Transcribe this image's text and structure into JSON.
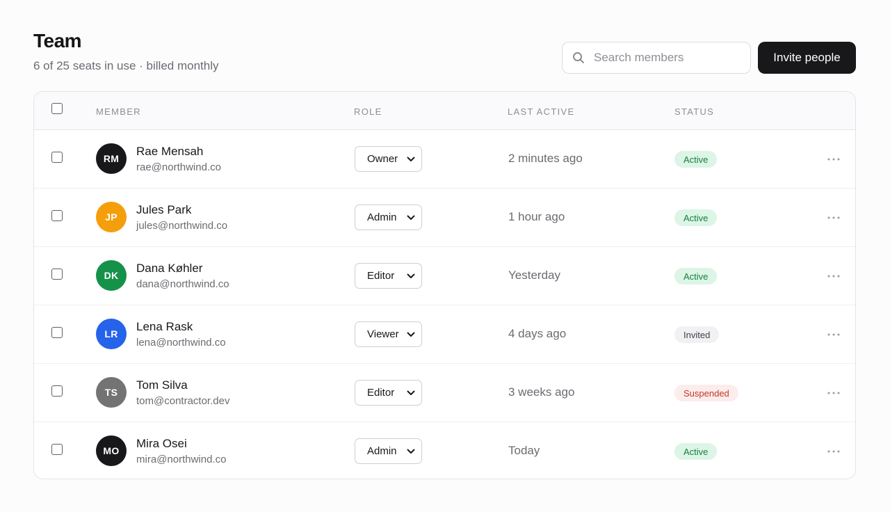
{
  "header": {
    "title": "Team",
    "subtitle": "6 of 25 seats in use · billed monthly",
    "search_placeholder": "Search members",
    "search_value": "",
    "invite_label": "Invite people"
  },
  "table": {
    "columns": {
      "member": "MEMBER",
      "role": "ROLE",
      "last_active": "LAST ACTIVE",
      "status": "STATUS"
    },
    "rows": [
      {
        "initials": "RM",
        "name": "Rae Mensah",
        "email": "rae@northwind.co",
        "role": "Owner",
        "last_active": "2 minutes ago",
        "status": "Active",
        "avatar_color": "#18181b"
      },
      {
        "initials": "JP",
        "name": "Jules Park",
        "email": "jules@northwind.co",
        "role": "Admin",
        "last_active": "1 hour ago",
        "status": "Active",
        "avatar_color": "#f59e0b"
      },
      {
        "initials": "DK",
        "name": "Dana Køhler",
        "email": "dana@northwind.co",
        "role": "Editor",
        "last_active": "Yesterday",
        "status": "Active",
        "avatar_color": "#16914a"
      },
      {
        "initials": "LR",
        "name": "Lena Rask",
        "email": "lena@northwind.co",
        "role": "Viewer",
        "last_active": "4 days ago",
        "status": "Invited",
        "avatar_color": "#2563eb"
      },
      {
        "initials": "TS",
        "name": "Tom Silva",
        "email": "tom@contractor.dev",
        "role": "Editor",
        "last_active": "3 weeks ago",
        "status": "Suspended",
        "avatar_color": "#737373"
      },
      {
        "initials": "MO",
        "name": "Mira Osei",
        "email": "mira@northwind.co",
        "role": "Admin",
        "last_active": "Today",
        "status": "Active",
        "avatar_color": "#18181b"
      }
    ]
  },
  "status_styles": {
    "Active": {
      "bg": "#dcf5e6",
      "fg": "#15803d"
    },
    "Invited": {
      "bg": "#f1f1f3",
      "fg": "#3f3f46"
    },
    "Suspended": {
      "bg": "#fdecec",
      "fg": "#c0392b"
    }
  },
  "icons": {
    "search": "search-icon",
    "role_dropdown": "chevron-down-icon",
    "row_menu": "more-horizontal-icon"
  }
}
